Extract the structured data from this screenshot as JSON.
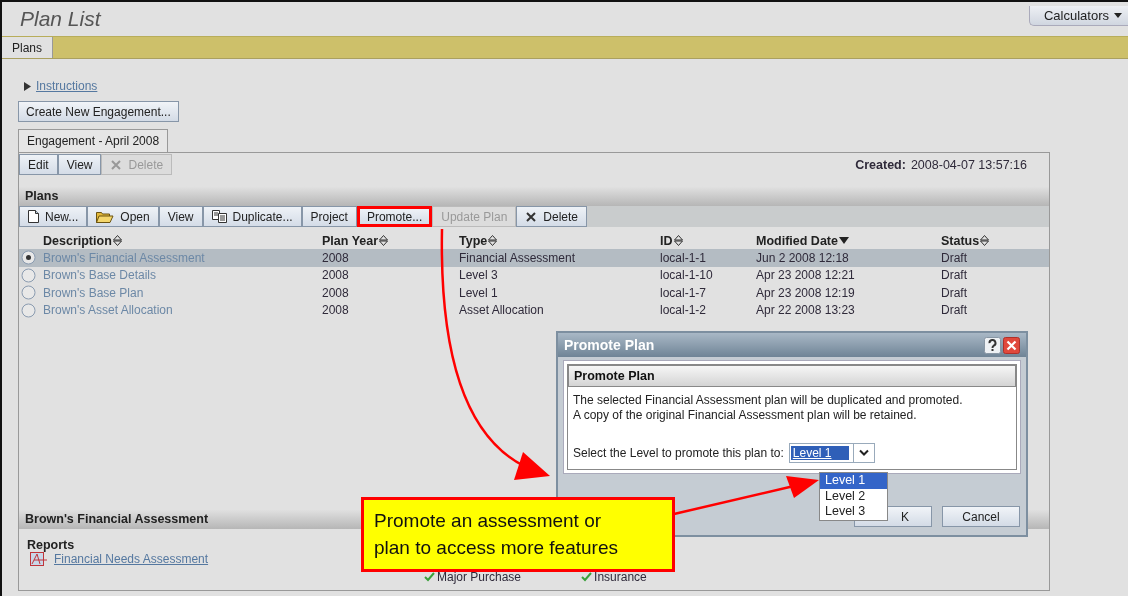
{
  "page": {
    "title": "Plan List",
    "calculators": "Calculators"
  },
  "tabs": [
    {
      "label": "Plans",
      "selected": true
    }
  ],
  "instructions": {
    "label": "Instructions",
    "expanded": false
  },
  "create_button": "Create New Engagement...",
  "engagement_tabs": [
    {
      "label": "Engagement - April 2008",
      "selected": true
    }
  ],
  "engagement_toolbar": [
    {
      "label": "Edit",
      "kind": "plain",
      "disabled": false
    },
    {
      "label": "View",
      "kind": "plain",
      "disabled": false
    },
    {
      "label": "Delete",
      "kind": "delete",
      "disabled": true
    }
  ],
  "created": {
    "label": "Created:",
    "value": "2008-04-07 13:57:16"
  },
  "plans": {
    "title": "Plans",
    "toolbar": [
      {
        "label": "New...",
        "kind": "new",
        "disabled": false,
        "highlighted": false
      },
      {
        "label": "Open",
        "kind": "open",
        "disabled": false,
        "highlighted": false
      },
      {
        "label": "View",
        "kind": "plain",
        "disabled": false,
        "highlighted": false
      },
      {
        "label": "Duplicate...",
        "kind": "duplicate",
        "disabled": false,
        "highlighted": false
      },
      {
        "label": "Project",
        "kind": "plain",
        "disabled": false,
        "highlighted": false
      },
      {
        "label": "Promote...",
        "kind": "plain",
        "disabled": false,
        "highlighted": true
      },
      {
        "label": "Update Plan",
        "kind": "plain",
        "disabled": true,
        "highlighted": false
      },
      {
        "label": "Delete",
        "kind": "delete",
        "disabled": false,
        "highlighted": false
      }
    ],
    "columns": [
      {
        "label": "Description",
        "sorted": false
      },
      {
        "label": "Plan Year",
        "sorted": false
      },
      {
        "label": "Type",
        "sorted": false
      },
      {
        "label": "ID",
        "sorted": false
      },
      {
        "label": "Modified Date",
        "sorted": true
      },
      {
        "label": "Status",
        "sorted": false
      }
    ],
    "rows": [
      {
        "selected": true,
        "cells": [
          "Brown's Financial Assessment",
          "2008",
          "Financial Assessment",
          "local-1-1",
          "Jun 2 2008 12:18",
          "Draft"
        ]
      },
      {
        "selected": false,
        "cells": [
          "Brown's Base Details",
          "2008",
          "Level 3",
          "local-1-10",
          "Apr 23 2008 12:21",
          "Draft"
        ]
      },
      {
        "selected": false,
        "cells": [
          "Brown's Base Plan",
          "2008",
          "Level 1",
          "local-1-7",
          "Apr 23 2008 12:19",
          "Draft"
        ]
      },
      {
        "selected": false,
        "cells": [
          "Brown's Asset Allocation",
          "2008",
          "Asset Allocation",
          "local-1-2",
          "Apr 22 2008 13:23",
          "Draft"
        ]
      }
    ]
  },
  "details": {
    "title": "Brown's Financial Assessment",
    "reports_label": "Reports",
    "reports": [
      "Financial Needs Assessment"
    ],
    "checks": [
      {
        "label": "Major Purchase",
        "checked": true
      },
      {
        "label": "Insurance",
        "checked": true
      }
    ]
  },
  "dialog": {
    "title": "Promote Plan",
    "section_title": "Promote Plan",
    "message": [
      "The selected Financial Assessment plan will be duplicated and promoted.",
      "A copy of the original Financial Assessment plan will be retained."
    ],
    "select_label": "Select the Level to promote this plan to:",
    "select_value": "Level 1",
    "options": [
      {
        "label": "Level 1",
        "selected": true
      },
      {
        "label": "Level 2",
        "selected": false
      },
      {
        "label": "Level 3",
        "selected": false
      }
    ],
    "ok": "K",
    "cancel": "Cancel"
  },
  "callout": "Promote an assessment or plan to access more features"
}
